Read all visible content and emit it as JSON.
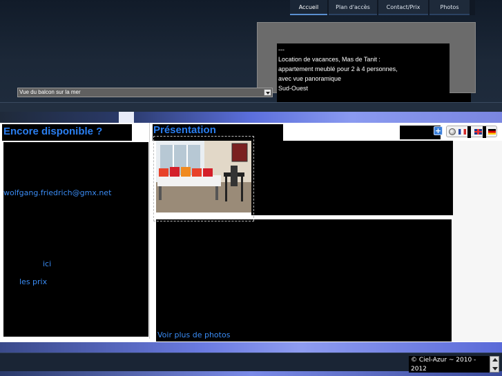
{
  "nav": {
    "items": [
      {
        "label": "Accueil",
        "active": true
      },
      {
        "label": "Plan d'accès",
        "active": false
      },
      {
        "label": "Contact/Prix",
        "active": false
      },
      {
        "label": "Photos",
        "active": false
      }
    ]
  },
  "intro": {
    "lines": [
      "---",
      "Location de vacances, Mas de Tanit :",
      "appartement meublé pour 2 à 4 personnes,",
      "avec vue panoramique",
      "Sud-Ouest"
    ]
  },
  "photo_select": {
    "value": "Vue du balcon sur la mer"
  },
  "left_panel": {
    "heading": "Encore disponible ?",
    "email_link": "wolfgang.friedrich@gmx.net",
    "here_link": "ici",
    "prices_link": "les prix"
  },
  "center_panel": {
    "heading": "Présentation",
    "more_photos_link": "Voir plus de photos"
  },
  "languages": {
    "plus_label": "+",
    "flag_names": [
      "globe-icon",
      "flag-fr-icon",
      "flag-en-icon",
      "flag-de-icon"
    ]
  },
  "footer": {
    "copyright": "© Ciel-Azur ~ 2010 - 2012"
  },
  "colors": {
    "accent_link": "#3a8cf5",
    "heading": "#2a7ef0",
    "header_bg": "#1a2535"
  }
}
